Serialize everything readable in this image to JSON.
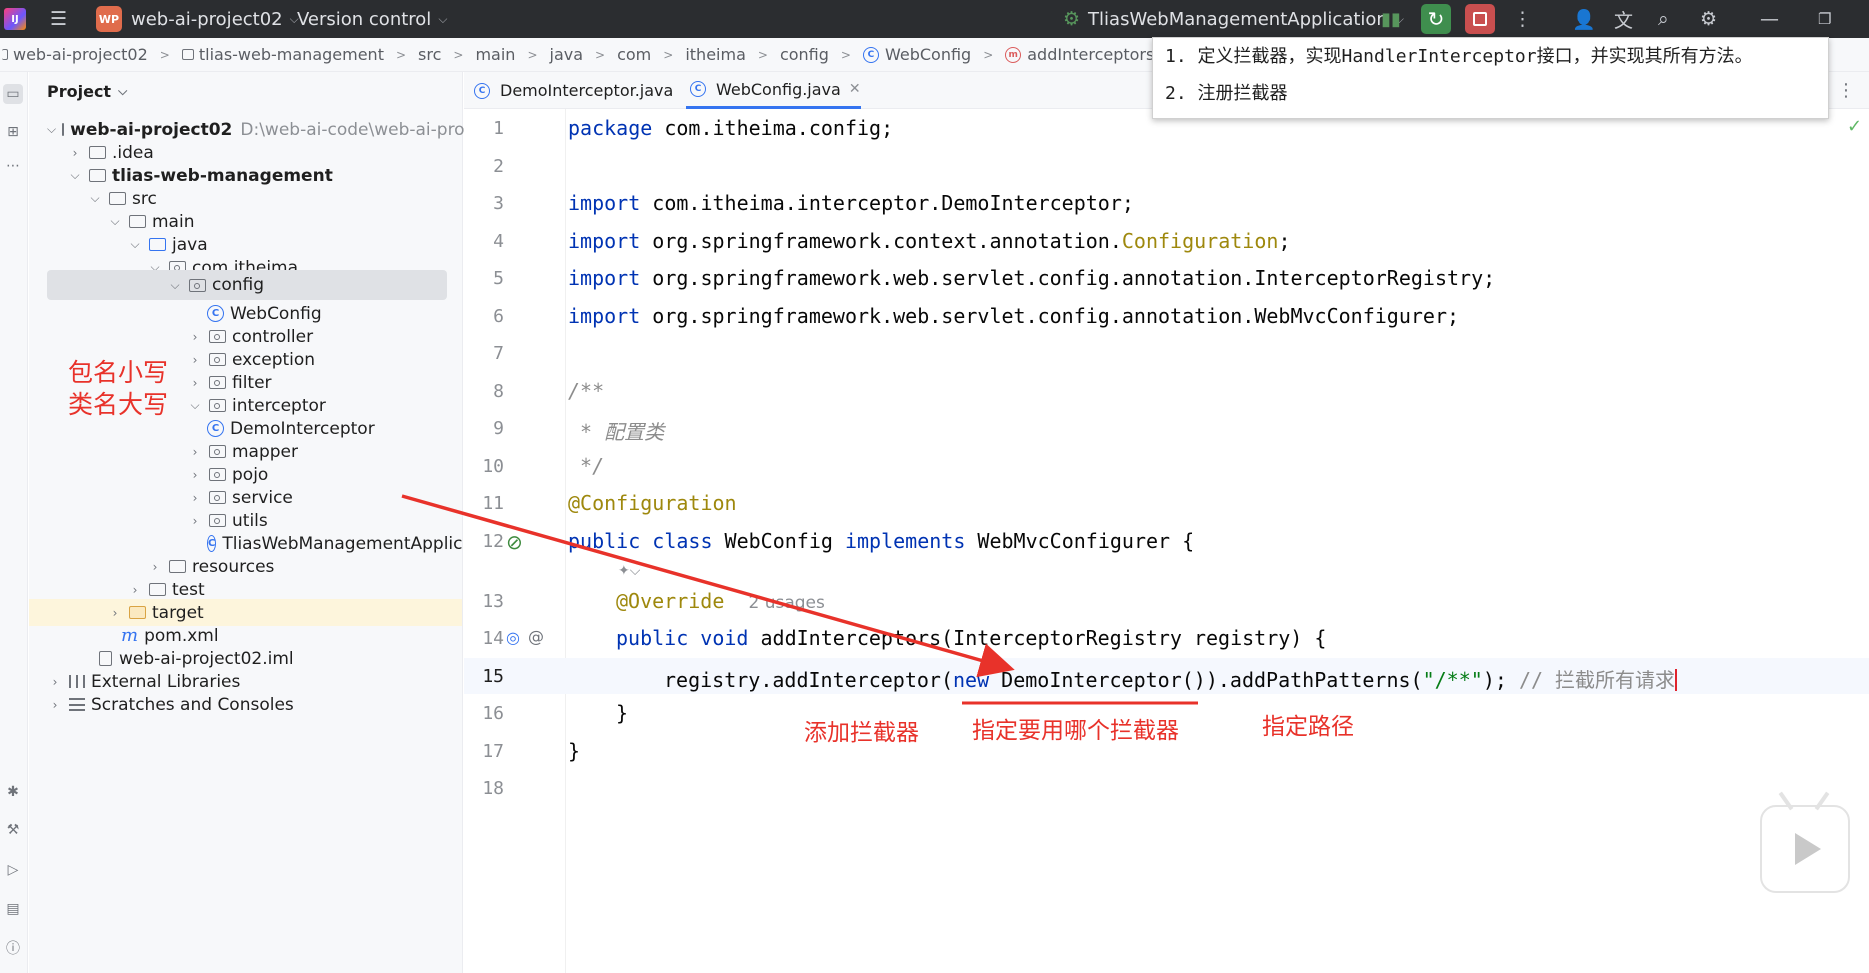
{
  "titlebar": {
    "project_badge": "WP",
    "project_name": "web-ai-project02",
    "vcs_label": "Version control",
    "run_config": "TliasWebManagementApplication"
  },
  "breadcrumb": [
    "web-ai-project02",
    "tlias-web-management",
    "src",
    "main",
    "java",
    "com",
    "itheima",
    "config",
    "WebConfig",
    "addInterceptors"
  ],
  "note": {
    "line1": "1. 定义拦截器，实现HandlerInterceptor接口，并实现其所有方法。",
    "line2": "2. 注册拦截器"
  },
  "project_panel": {
    "header": "Project",
    "root_name": "web-ai-project02",
    "root_path": "D:\\web-ai-code\\web-ai-proj",
    "items": {
      "idea": ".idea",
      "module": "tlias-web-management",
      "src": "src",
      "main": "main",
      "java": "java",
      "pkg": "com.itheima",
      "config": "config",
      "webconfig": "WebConfig",
      "controller": "controller",
      "exception": "exception",
      "filter": "filter",
      "interceptor": "interceptor",
      "demointerceptor": "DemoInterceptor",
      "mapper": "mapper",
      "pojo": "pojo",
      "service": "service",
      "utils": "utils",
      "app": "TliasWebManagementApplica",
      "resources": "resources",
      "test": "test",
      "target": "target",
      "pom": "pom.xml",
      "iml": "web-ai-project02.iml",
      "ext_libs": "External Libraries",
      "scratches": "Scratches and Consoles"
    }
  },
  "tabs": [
    "DemoInterceptor.java",
    "WebConfig.java"
  ],
  "code": {
    "l1_kw": "package",
    "l1_rest": " com.itheima.config;",
    "l3_kw": "import",
    "l3_rest": " com.itheima.interceptor.DemoInterceptor;",
    "l4_kw": "import",
    "l4_rest": " org.springframework.context.annotation.",
    "l4_ann": "Configuration",
    "l4_end": ";",
    "l5_kw": "import",
    "l5_rest": " org.springframework.web.servlet.config.annotation.InterceptorRegistry;",
    "l6_kw": "import",
    "l6_rest": " org.springframework.web.servlet.config.annotation.WebMvcConfigurer;",
    "l8": "/**",
    "l9": " * 配置类",
    "l10": " */",
    "l11": "@Configuration",
    "l12_kw1": "public class",
    "l12_name": " WebConfig ",
    "l12_kw2": "implements",
    "l12_rest": " WebMvcConfigurer {",
    "override": "@Override",
    "usages": "2 usages",
    "l14_kw": "public void",
    "l14_rest": " addInterceptors(InterceptorRegistry registry) {",
    "l15_a": "registry.addInterceptor(",
    "l15_kw": "new",
    "l15_b": " DemoInterceptor()).addPathPatterns(",
    "l15_str": "\"/**\"",
    "l15_c": "); ",
    "l15_cmt": "// 拦截所有请求",
    "l16": "}",
    "l17": "}"
  },
  "annotations": {
    "pkg_lower": "包名小写",
    "cls_upper": "类名大写",
    "add_interceptor": "添加拦截器",
    "which_interceptor": "指定要用哪个拦截器",
    "path": "指定路径"
  },
  "colors": {
    "annotation_red": "#e8322a",
    "keyword": "#0033b3",
    "annotation_yellow": "#9e880d",
    "string": "#067d17"
  }
}
